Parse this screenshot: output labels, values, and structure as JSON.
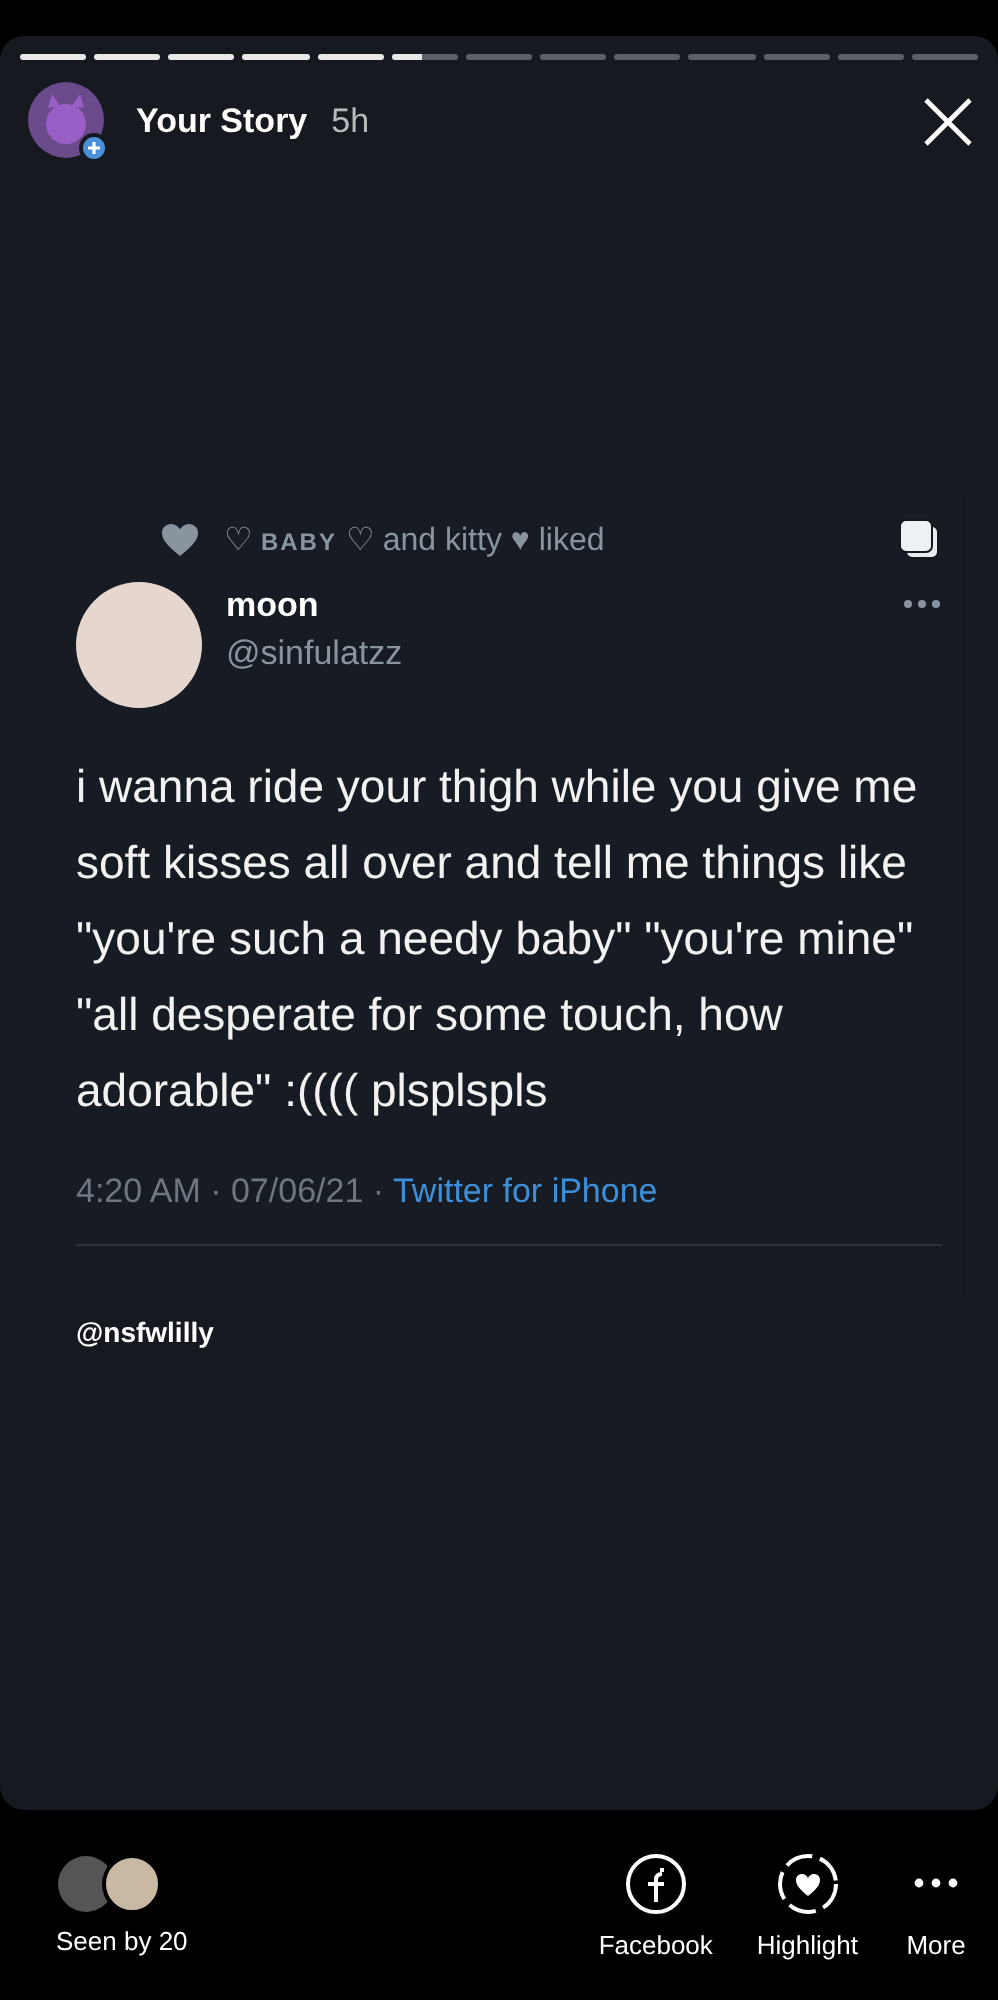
{
  "progress": [
    {
      "level": 1
    },
    {
      "level": 1
    },
    {
      "level": 1
    },
    {
      "level": 1
    },
    {
      "level": 1
    },
    {
      "level": 0.45
    },
    {
      "level": 0
    },
    {
      "level": 0
    },
    {
      "level": 0
    },
    {
      "level": 0
    },
    {
      "level": 0
    },
    {
      "level": 0
    },
    {
      "level": 0
    }
  ],
  "header": {
    "title": "Your Story",
    "time": "5h"
  },
  "tweet": {
    "liked_by": [
      {
        "text": "♡ ",
        "kind": "plain"
      },
      {
        "text": "BABY",
        "kind": "smallcaps"
      },
      {
        "text": " ♡ and kitty ♥ liked",
        "kind": "plain"
      }
    ],
    "name": "moon",
    "handle": "@sinfulatzz",
    "body": "i wanna ride your thigh while you give me soft kisses all over and tell me things like \"you're such a needy baby\" \"you're mine\" \"all desperate for some touch, how adorable\" :(((( plsplspls",
    "time": "4:20 AM · 07/06/21 · ",
    "source": "Twitter for iPhone"
  },
  "mention": "@nsfwlilly",
  "footer": {
    "seen": "Seen by 20",
    "actions": [
      {
        "label": "Facebook",
        "kind": "share"
      },
      {
        "label": "Highlight",
        "kind": "highlight"
      },
      {
        "label": "More",
        "kind": "more"
      }
    ]
  }
}
